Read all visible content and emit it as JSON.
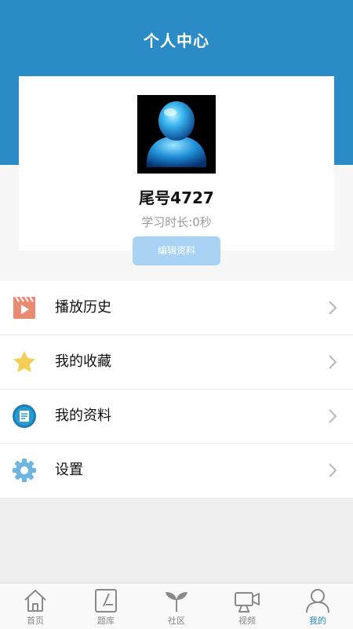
{
  "header": {
    "title": "个人中心"
  },
  "profile": {
    "username": "尾号4727",
    "study_time": "学习时长:0秒",
    "edit_label": "编辑资料"
  },
  "menu": {
    "items": [
      {
        "label": "播放历史",
        "icon": "play-history-icon"
      },
      {
        "label": "我的收藏",
        "icon": "star-icon"
      },
      {
        "label": "我的资料",
        "icon": "document-icon"
      },
      {
        "label": "设置",
        "icon": "gear-icon"
      }
    ]
  },
  "tabbar": {
    "items": [
      {
        "label": "首页",
        "icon": "home-icon"
      },
      {
        "label": "题库",
        "icon": "question-bank-icon"
      },
      {
        "label": "社区",
        "icon": "sprout-icon"
      },
      {
        "label": "视频",
        "icon": "video-camera-icon"
      },
      {
        "label": "我的",
        "icon": "user-icon",
        "active": true
      }
    ]
  },
  "colors": {
    "primary": "#2a8bc7",
    "button": "#a9d3f5",
    "tab_active": "#2a8bc7"
  }
}
